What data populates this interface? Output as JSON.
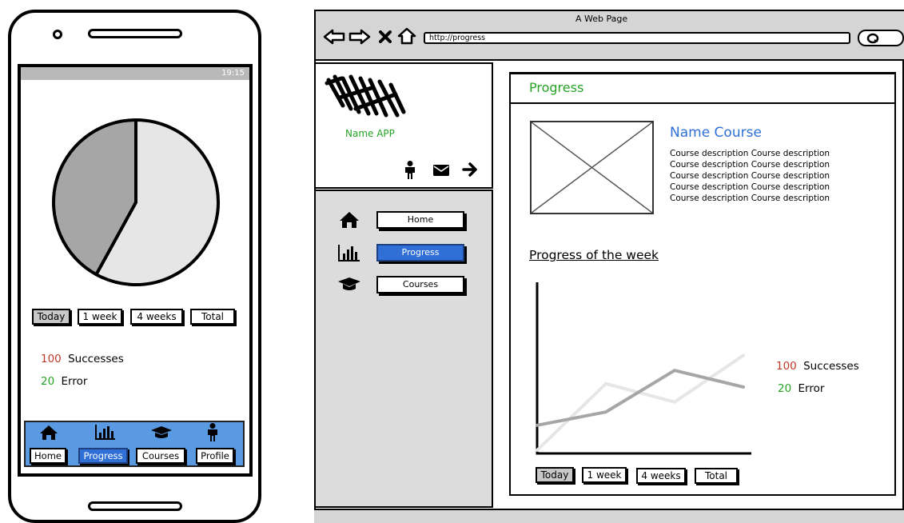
{
  "phone": {
    "status_text": "19:15",
    "filters": [
      {
        "label": "Today",
        "active": true
      },
      {
        "label": "1 week",
        "active": false
      },
      {
        "label": "4 weeks",
        "active": false
      },
      {
        "label": "Total",
        "active": false
      }
    ],
    "stats": [
      {
        "value": "100",
        "label": "Successes",
        "color": "#c0392b"
      },
      {
        "value": "20",
        "label": "Error",
        "color": "#27a227"
      }
    ],
    "bottom_nav": [
      {
        "label": "Home",
        "icon": "home-icon",
        "active": false
      },
      {
        "label": "Progress",
        "icon": "bar-chart-icon",
        "active": true
      },
      {
        "label": "Courses",
        "icon": "graduation-cap-icon",
        "active": false
      },
      {
        "label": "Profile",
        "icon": "user-icon",
        "active": false
      }
    ]
  },
  "browser": {
    "window_title": "A Web Page",
    "url": "http://progress",
    "app_name": "Name APP",
    "sidebar": [
      {
        "label": "Home",
        "icon": "home-icon",
        "active": false
      },
      {
        "label": "Progress",
        "icon": "bar-chart-icon",
        "active": true
      },
      {
        "label": "Courses",
        "icon": "graduation-cap-icon",
        "active": false
      }
    ],
    "page_title": "Progress",
    "course": {
      "name": "Name Course",
      "description_lines": [
        "Course description  Course description",
        "Course description  Course description",
        "Course description  Course description",
        "Course description  Course description",
        "Course description  Course description"
      ]
    },
    "chart_title": "Progress of the week",
    "filters": [
      {
        "label": "Today",
        "active": true
      },
      {
        "label": "1 week",
        "active": false
      },
      {
        "label": "4 weeks",
        "active": false
      },
      {
        "label": "Total",
        "active": false
      }
    ],
    "stats": [
      {
        "value": "100",
        "label": "Successes",
        "color": "#c0392b"
      },
      {
        "value": "20",
        "label": "Error",
        "color": "#27a227"
      }
    ]
  },
  "chart_data": [
    {
      "type": "pie",
      "values": [
        58,
        42
      ],
      "colors": [
        "#e6e6e6",
        "#a6a6a6"
      ]
    },
    {
      "type": "line",
      "x": [
        0,
        1,
        2,
        3
      ],
      "series": [
        {
          "values": [
            0.15,
            0.23,
            0.48,
            0.38
          ],
          "color": "#a6a6a6"
        },
        {
          "values": [
            0.0,
            0.4,
            0.29,
            0.57
          ],
          "color": "#e6e6e6"
        }
      ],
      "ylim": [
        0,
        1
      ]
    }
  ]
}
